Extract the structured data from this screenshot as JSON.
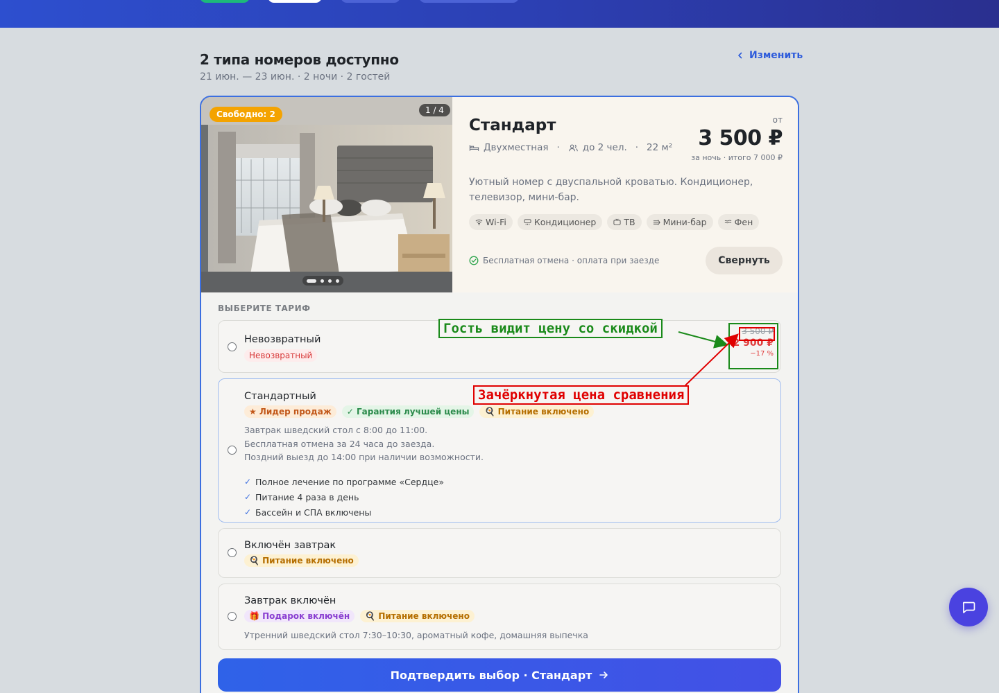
{
  "header": {
    "title": "2 типа номеров доступно",
    "subtitle": "21 июн. — 23 июн. · 2 ночи · 2 гостей",
    "change_label": "Изменить"
  },
  "room": {
    "free_badge": "Свободно: 2",
    "photo_counter": "1 / 4",
    "name": "Стандарт",
    "bed": "Двухместная",
    "guests": "до 2 чел.",
    "area": "22 м²",
    "price_from": "от",
    "price": "3 500 ₽",
    "price_note": "за ночь · итого 7 000 ₽",
    "description": "Уютный номер с двуспальной кроватью. Кондиционер, телевизор, мини-бар.",
    "amenities": [
      "Wi-Fi",
      "Кондиционер",
      "ТВ",
      "Мини-бар",
      "Фен"
    ],
    "cancel_note": "Бесплатная отмена · оплата при заезде",
    "collapse_label": "Свернуть"
  },
  "tariffs": {
    "label": "ВЫБЕРИТЕ ТАРИФ",
    "items": [
      {
        "name": "Невозвратный",
        "tag": "Невозвратный",
        "old_price": "3 500 ₽",
        "new_price": "2 900 ₽",
        "discount": "−17 %"
      },
      {
        "name": "Стандартный",
        "tags": [
          "★ Лидер продаж",
          "✓ Гарантия лучшей цены",
          "🍳 Питание включено"
        ],
        "desc_lines": [
          "Завтрак шведский стол с 8:00 до 11:00.",
          "Бесплатная отмена за 24 часа до заезда.",
          "Поздний выезд до 14:00 при наличии возможности."
        ],
        "perks": [
          "Полное лечение по программе «Сердце»",
          "Питание 4 раза в день",
          "Бассейн и СПА включены"
        ]
      },
      {
        "name": "Включён завтрак",
        "tags": [
          "🍳 Питание включено"
        ]
      },
      {
        "name": "Завтрак включён",
        "tags": [
          "🎁 Подарок включён",
          "🍳 Питание включено"
        ],
        "desc": "Утренний шведский стол 7:30–10:30, ароматный кофе, домашняя выпечка"
      }
    ]
  },
  "confirm_label": "Подтвердить выбор · Стандарт",
  "annotations": {
    "green": "Гость видит цену со скидкой",
    "red": "Зачёркнутая цена сравнения"
  },
  "colors": {
    "accent": "#3c6fe0",
    "discount_red": "#e03b3b",
    "badge_orange": "#f4a300",
    "chat_purple": "#4a42e0"
  },
  "icons": [
    "chevron-left-icon",
    "bed-icon",
    "users-icon",
    "wifi-icon",
    "snowflake-icon",
    "tv-icon",
    "fridge-icon",
    "hairdryer-icon",
    "check-circle-icon",
    "arrow-right-icon",
    "chat-icon"
  ]
}
